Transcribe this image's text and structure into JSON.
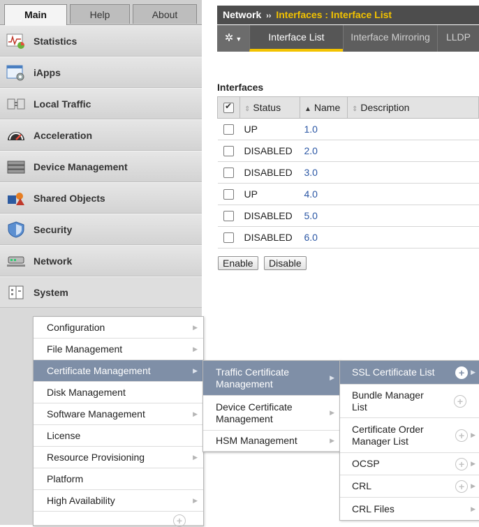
{
  "nav": {
    "tabs": [
      "Main",
      "Help",
      "About"
    ],
    "items": [
      {
        "label": "Statistics",
        "icon": "statistics-icon"
      },
      {
        "label": "iApps",
        "icon": "iapps-icon"
      },
      {
        "label": "Local Traffic",
        "icon": "local-traffic-icon"
      },
      {
        "label": "Acceleration",
        "icon": "acceleration-icon"
      },
      {
        "label": "Device Management",
        "icon": "device-management-icon"
      },
      {
        "label": "Shared Objects",
        "icon": "shared-objects-icon"
      },
      {
        "label": "Security",
        "icon": "security-icon"
      },
      {
        "label": "Network",
        "icon": "network-icon"
      },
      {
        "label": "System",
        "icon": "system-icon"
      }
    ]
  },
  "system_menu": [
    {
      "label": "Configuration",
      "arrow": true
    },
    {
      "label": "File Management",
      "arrow": true
    },
    {
      "label": "Certificate Management",
      "arrow": true,
      "selected": true
    },
    {
      "label": "Disk Management",
      "arrow": false
    },
    {
      "label": "Software Management",
      "arrow": true
    },
    {
      "label": "License",
      "arrow": false
    },
    {
      "label": "Resource Provisioning",
      "arrow": true
    },
    {
      "label": "Platform",
      "arrow": false
    },
    {
      "label": "High Availability",
      "arrow": true
    }
  ],
  "cert_menu": [
    {
      "label": "Traffic Certificate Management",
      "selected": true
    },
    {
      "label": "Device Certificate Management",
      "selected": false
    },
    {
      "label": "HSM Management",
      "selected": false
    }
  ],
  "ssl_menu": [
    {
      "label": "SSL Certificate List",
      "plus": true,
      "arrow": true,
      "selected": true
    },
    {
      "label": "Bundle Manager List",
      "plus": true,
      "arrow": false
    },
    {
      "label": "Certificate Order Manager List",
      "plus": true,
      "arrow": true
    },
    {
      "label": "OCSP",
      "plus": true,
      "arrow": true
    },
    {
      "label": "CRL",
      "plus": true,
      "arrow": true
    },
    {
      "label": "CRL Files",
      "plus": false,
      "arrow": true
    }
  ],
  "header": {
    "crumb_root": "Network",
    "crumb_sep": "››",
    "crumb_path": "Interfaces : Interface List",
    "tabs": [
      "Interface List",
      "Interface Mirroring",
      "LLDP"
    ]
  },
  "section_title": "Interfaces",
  "table": {
    "columns": [
      "Status",
      "Name",
      "Description"
    ],
    "rows": [
      {
        "status": "UP",
        "name": "1.0",
        "description": ""
      },
      {
        "status": "DISABLED",
        "name": "2.0",
        "description": ""
      },
      {
        "status": "DISABLED",
        "name": "3.0",
        "description": ""
      },
      {
        "status": "UP",
        "name": "4.0",
        "description": ""
      },
      {
        "status": "DISABLED",
        "name": "5.0",
        "description": ""
      },
      {
        "status": "DISABLED",
        "name": "6.0",
        "description": ""
      }
    ]
  },
  "buttons": {
    "enable": "Enable",
    "disable": "Disable"
  },
  "colors": {
    "accent": "#f2c200",
    "selected_menu": "#7f8fa7",
    "link": "#2b57a5"
  }
}
